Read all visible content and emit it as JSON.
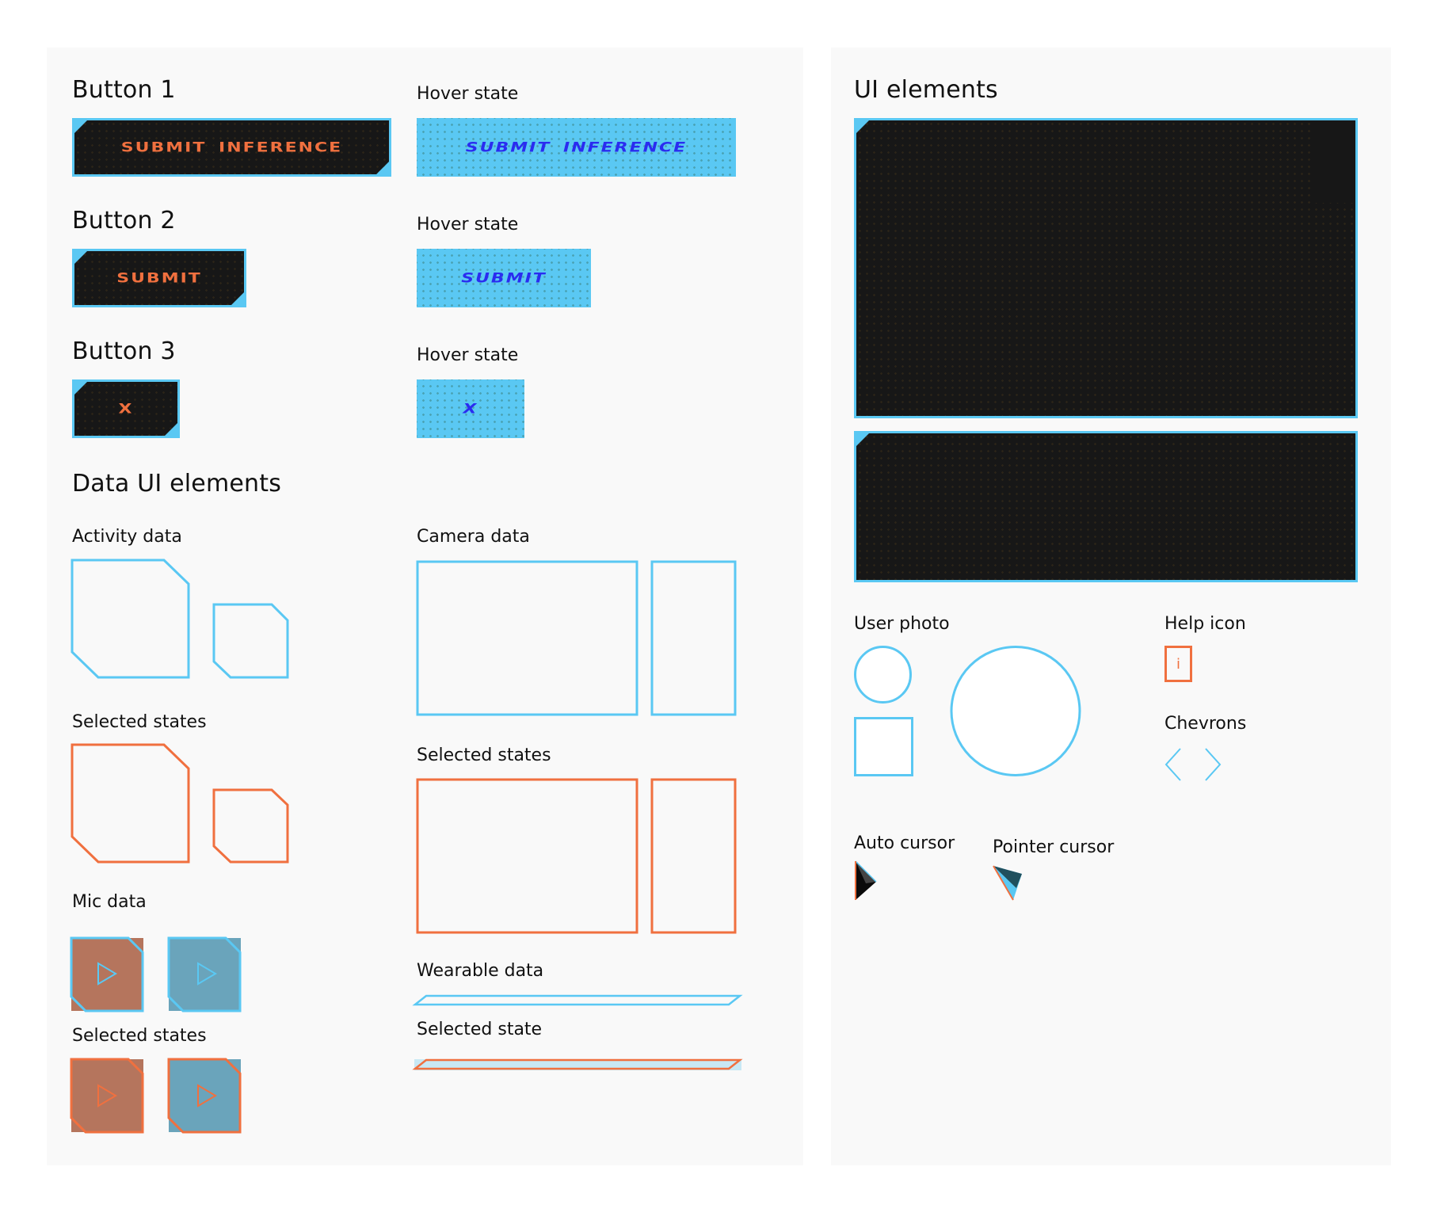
{
  "colors": {
    "accent_blue": "#5ac8f3",
    "accent_orange": "#f0703f",
    "hover_text_blue": "#2a2cf0",
    "dark_fill": "#171717",
    "mic_brown": "#b5755d",
    "mic_steel": "#6aa4bb",
    "wearable_selected_fill": "#c8e8f4"
  },
  "left": {
    "button1": {
      "title": "Button 1",
      "label": "SUBMIT INFERENCE",
      "hover_title": "Hover state",
      "hover_label": "SUBMIT INFERENCE"
    },
    "button2": {
      "title": "Button 2",
      "label": "SUBMIT",
      "hover_title": "Hover state",
      "hover_label": "SUBMIT"
    },
    "button3": {
      "title": "Button 3",
      "label": "X",
      "hover_title": "Hover state",
      "hover_label": "X"
    },
    "data_section_title": "Data UI elements",
    "activity": {
      "title": "Activity data",
      "selected_title": "Selected states"
    },
    "camera": {
      "title": "Camera data",
      "selected_title": "Selected states"
    },
    "mic": {
      "title": "Mic data",
      "selected_title": "Selected states",
      "play_icon": "play-icon"
    },
    "wearable": {
      "title": "Wearable data",
      "selected_title": "Selected state"
    }
  },
  "right": {
    "title": "UI elements",
    "user_photo_title": "User photo",
    "help_icon_title": "Help icon",
    "help_icon_glyph": "i",
    "chevrons_title": "Chevrons",
    "chevron_left": "chevron-left-icon",
    "chevron_right": "chevron-right-icon",
    "auto_cursor_title": "Auto cursor",
    "pointer_cursor_title": "Pointer cursor"
  }
}
